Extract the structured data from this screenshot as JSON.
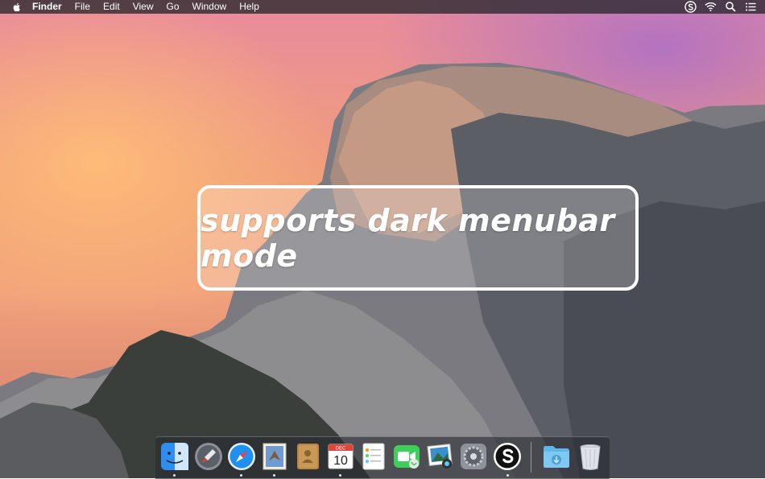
{
  "menubar": {
    "apple_icon": "apple-icon",
    "app_name": "Finder",
    "menus": [
      "File",
      "Edit",
      "View",
      "Go",
      "Window",
      "Help"
    ],
    "status_icons": [
      "s-app-icon",
      "wifi-icon",
      "search-icon",
      "list-icon"
    ]
  },
  "banner": {
    "text": "supports dark menubar mode"
  },
  "dock": {
    "apps": [
      {
        "icon": "finder-icon",
        "running": true
      },
      {
        "icon": "launchpad-icon",
        "running": false
      },
      {
        "icon": "safari-icon",
        "running": true
      },
      {
        "icon": "mail-icon",
        "running": true
      },
      {
        "icon": "contacts-icon",
        "running": false
      },
      {
        "icon": "calendar-icon",
        "month": "DEC",
        "day": "10",
        "running": true
      },
      {
        "icon": "reminders-icon",
        "running": false
      },
      {
        "icon": "facetime-icon",
        "running": false
      },
      {
        "icon": "iphoto-icon",
        "running": false
      },
      {
        "icon": "system-preferences-icon",
        "running": false
      },
      {
        "icon": "s-app-icon",
        "running": true
      }
    ],
    "stacks": [
      {
        "icon": "downloads-folder-icon"
      },
      {
        "icon": "trash-icon"
      }
    ]
  }
}
